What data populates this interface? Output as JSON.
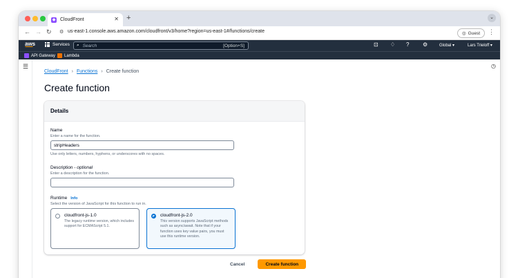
{
  "browser": {
    "tab_title": "CloudFront",
    "new_tab": "+",
    "url": "us-east-1.console.aws.amazon.com/cloudfront/v3/home?region=us-east-1#/functions/create",
    "profile_label": "Guest"
  },
  "aws_header": {
    "logo": "aws",
    "services_label": "Services",
    "search_placeholder": "Search",
    "search_shortcut": "[Option+S]",
    "region_label": "Global",
    "user_label": "Lars Trieloff",
    "favorites": [
      {
        "label": "API Gateway",
        "icon": "api-gateway-icon",
        "color": "#8c4fff"
      },
      {
        "label": "Lambda",
        "icon": "lambda-icon",
        "color": "#ed7100"
      }
    ]
  },
  "breadcrumb": {
    "items": [
      "CloudFront",
      "Functions",
      "Create function"
    ]
  },
  "page": {
    "title": "Create function"
  },
  "details": {
    "header": "Details",
    "name": {
      "label": "Name",
      "description": "Enter a name for the function.",
      "value": "stripHeaders",
      "constraint": "Use only letters, numbers, hyphens, or underscores with no spaces."
    },
    "description": {
      "label": "Description - ",
      "label_optional": "optional",
      "description": "Enter a description for the function.",
      "value": ""
    },
    "runtime": {
      "label": "Runtime",
      "info": "Info",
      "description": "Select the version of JavaScript for this function to run in.",
      "options": [
        {
          "title": "cloudfront-js-1.0",
          "description": "The legacy runtime version, which includes support for ECMAScript 5.1.",
          "selected": false
        },
        {
          "title": "cloudfront-js-2.0",
          "description": "This version supports JavaScript methods such as async/await. Note that if your function uses key value pairs, you must use this runtime version.",
          "selected": true
        }
      ]
    }
  },
  "actions": {
    "cancel": "Cancel",
    "create": "Create function"
  },
  "colors": {
    "accent": "#0972d3",
    "primary_button": "#ff9900",
    "header_bg": "#232f3e"
  }
}
